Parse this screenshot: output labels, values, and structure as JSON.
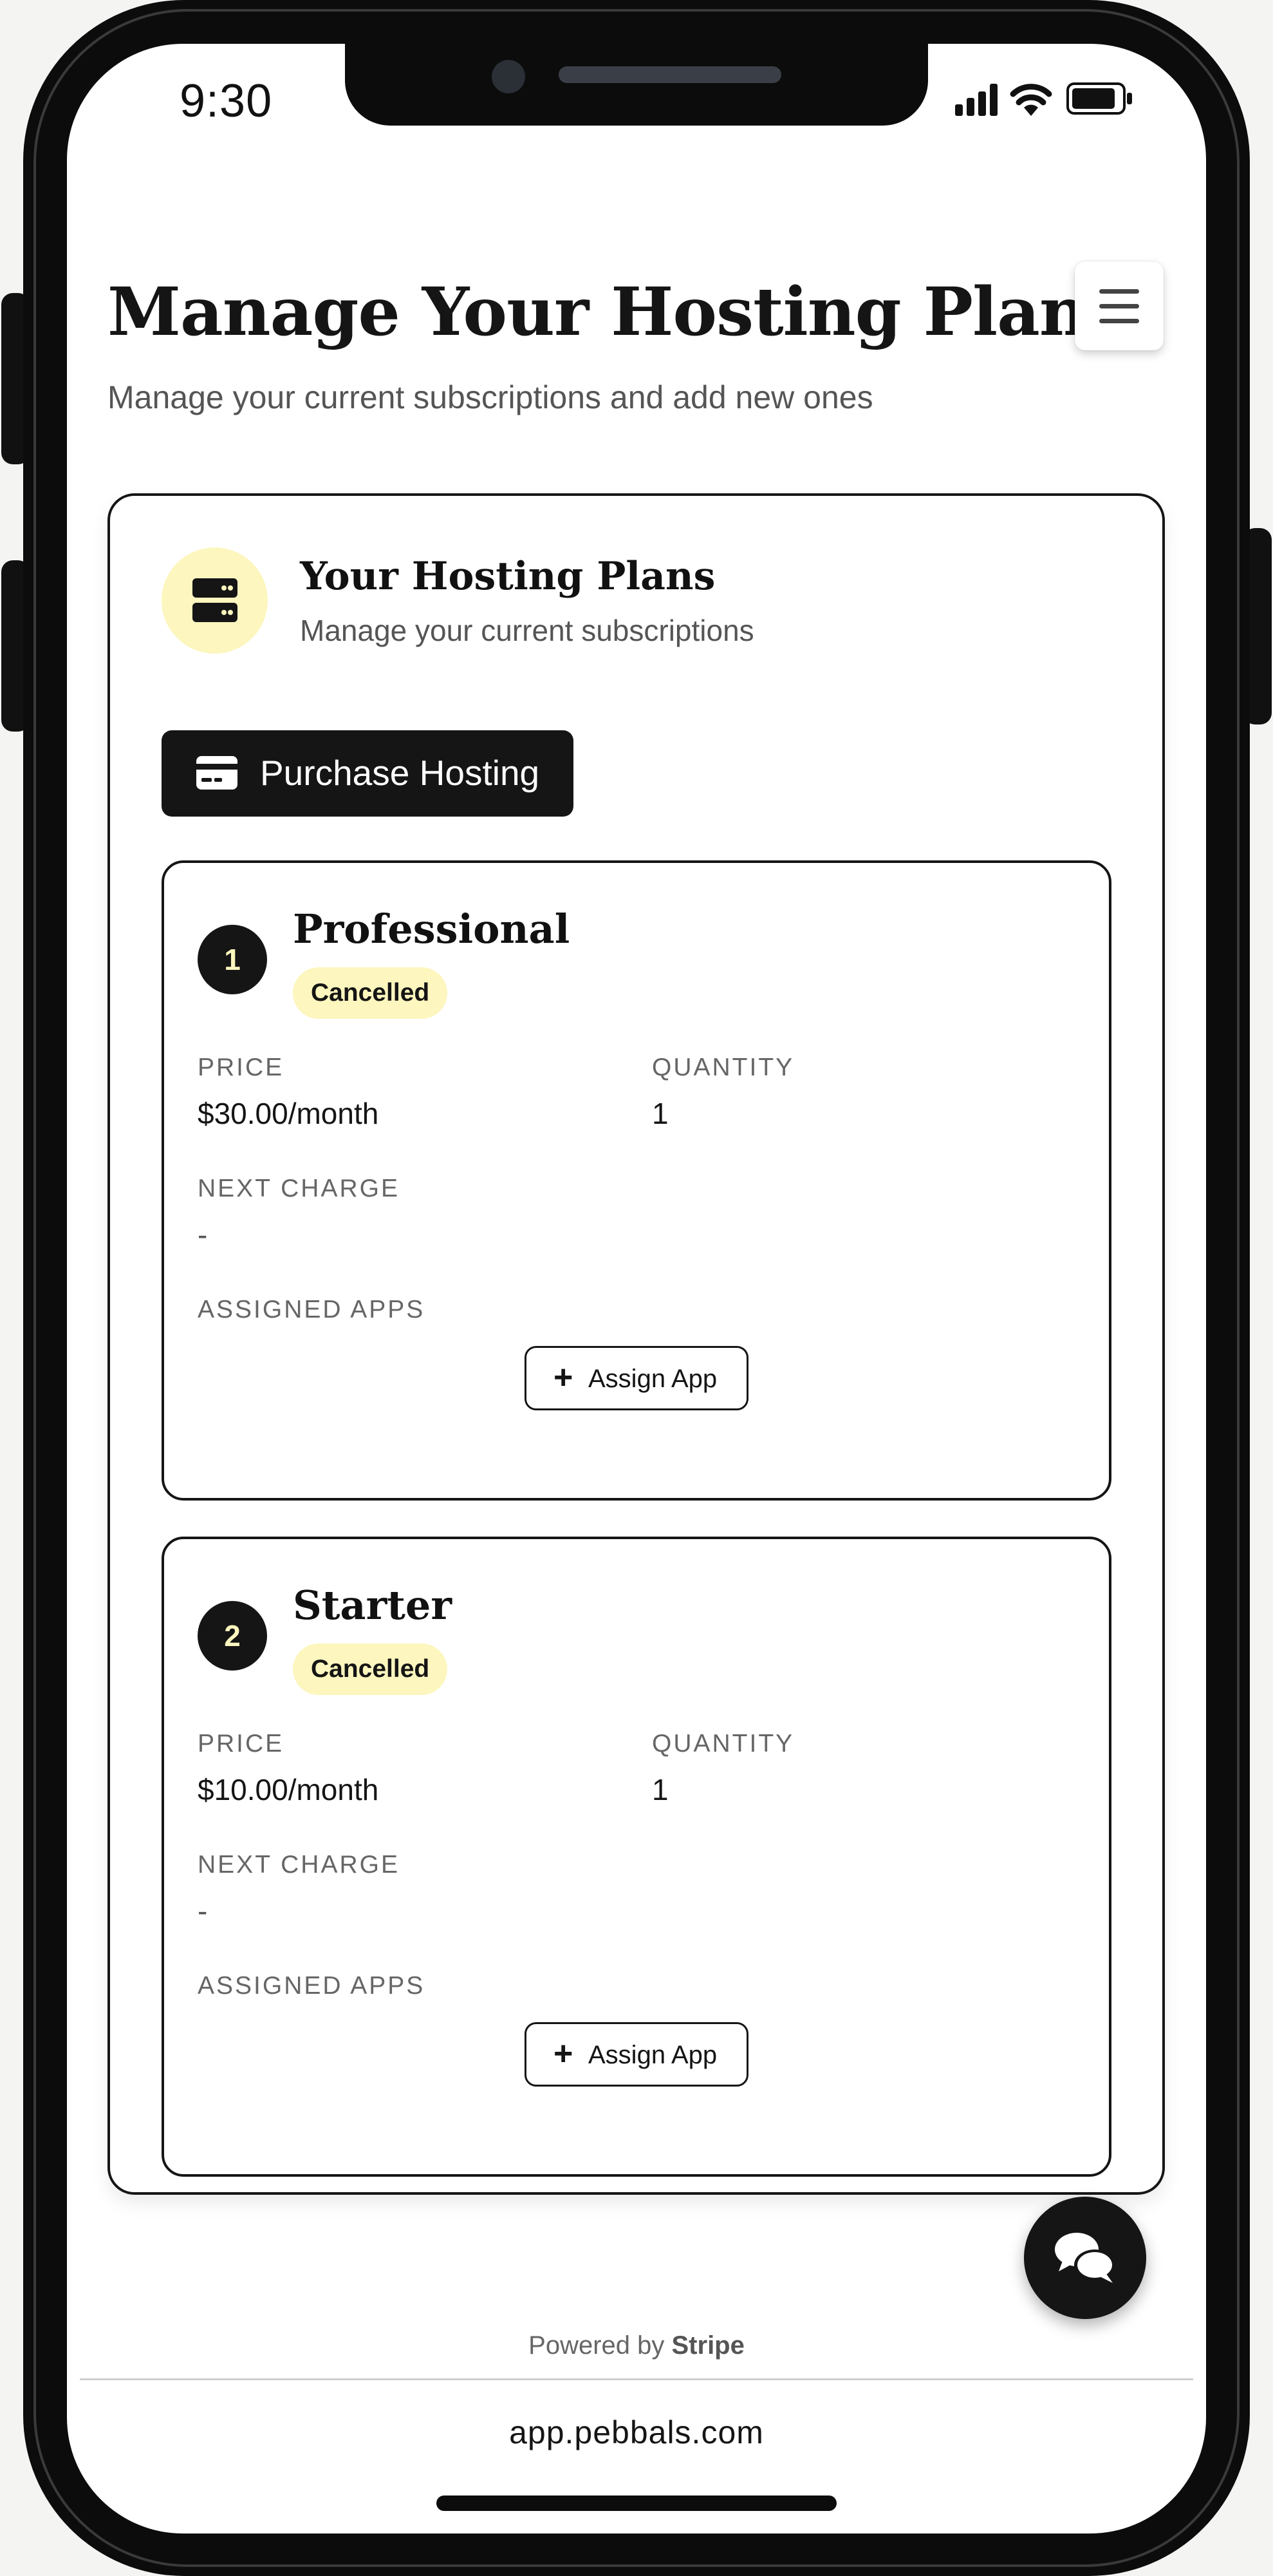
{
  "status_bar": {
    "time": "9:30",
    "icons": [
      "signal-icon",
      "wifi-icon",
      "battery-icon"
    ]
  },
  "header": {
    "title": "Manage Your Hosting Plans",
    "subtitle": "Manage your current subscriptions and add new ones",
    "menu_icon": "hamburger-menu-icon"
  },
  "plans_section": {
    "title": "Your Hosting Plans",
    "subtitle": "Manage your current subscriptions",
    "icon": "server-icon",
    "purchase_label": "Purchase Hosting",
    "purchase_icon": "credit-card-icon"
  },
  "subscriptions": [
    {
      "number": "1",
      "name": "Professional",
      "status": "Cancelled",
      "price_label": "PRICE",
      "price": "$30.00/month",
      "quantity_label": "QUANTITY",
      "quantity": "1",
      "next_charge_label": "NEXT CHARGE",
      "next_charge": "-",
      "assigned_apps_label": "ASSIGNED APPS",
      "assign_label": "Assign App"
    },
    {
      "number": "2",
      "name": "Starter",
      "status": "Cancelled",
      "price_label": "PRICE",
      "price": "$10.00/month",
      "quantity_label": "QUANTITY",
      "quantity": "1",
      "next_charge_label": "NEXT CHARGE",
      "next_charge": "-",
      "assigned_apps_label": "ASSIGNED APPS",
      "assign_label": "Assign App"
    }
  ],
  "footer": {
    "powered_prefix": "Powered by",
    "powered_brand": "Stripe",
    "url": "app.pebbals.com"
  },
  "colors": {
    "accent": "#fdf6be",
    "dark": "#151515",
    "muted": "#666666"
  },
  "chat_icon": "chat-bubbles-icon"
}
